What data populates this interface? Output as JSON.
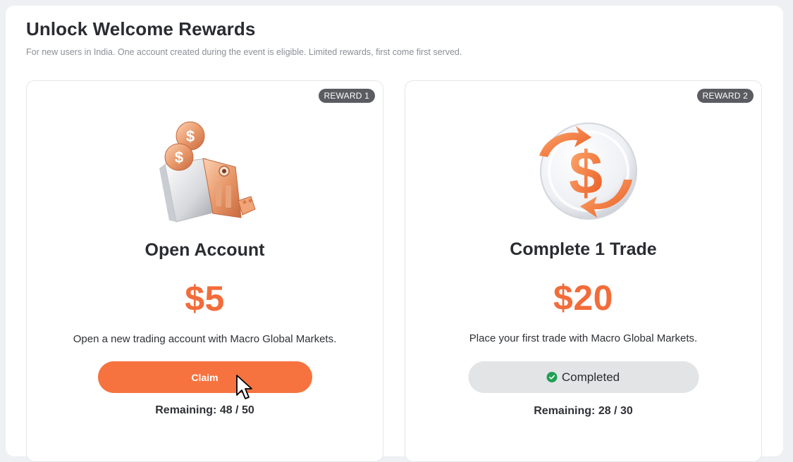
{
  "header": {
    "title": "Unlock Welcome Rewards",
    "subtitle": "For new users in India. One account created during the event is eligible. Limited rewards, first come first served."
  },
  "rewards": [
    {
      "badge": "REWARD 1",
      "title": "Open Account",
      "amount": "$5",
      "description": "Open a new trading account with Macro Global Markets.",
      "button_label": "Claim",
      "remaining": "Remaining: 48 / 50",
      "illustration": "safe-with-coins-icon"
    },
    {
      "badge": "REWARD 2",
      "title": "Complete 1 Trade",
      "amount": "$20",
      "description": "Place your first trade with Macro Global Markets.",
      "button_label": "Completed",
      "remaining": "Remaining: 28 / 30",
      "illustration": "dollar-coin-cycle-icon"
    }
  ],
  "colors": {
    "accent": "#f6733f",
    "amount": "#f26c3a",
    "badge_bg": "#5a5c61",
    "completed_bg": "#e3e4e6",
    "check_green": "#1fa055"
  }
}
